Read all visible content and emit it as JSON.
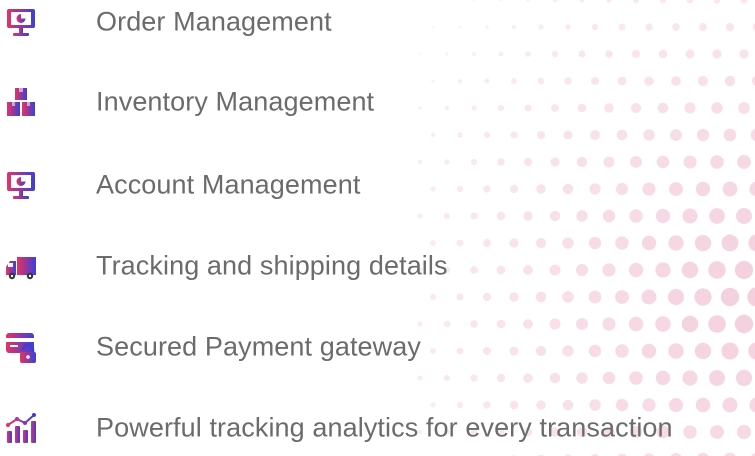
{
  "colors": {
    "text": "#6b6b6b",
    "icon_gradient_start": "#e63262",
    "icon_gradient_end": "#3b3fd8",
    "dot_color": "#f2c6d8"
  },
  "features": [
    {
      "label": "Order Management",
      "icon": "monitor-chart-icon"
    },
    {
      "label": "Inventory Management",
      "icon": "boxes-icon"
    },
    {
      "label": "Account Management",
      "icon": "monitor-chart-icon"
    },
    {
      "label": "Tracking and shipping details",
      "icon": "truck-icon"
    },
    {
      "label": "Secured Payment gateway",
      "icon": "card-lock-icon"
    },
    {
      "label": "Powerful tracking analytics for every transaction",
      "icon": "analytics-icon"
    }
  ]
}
